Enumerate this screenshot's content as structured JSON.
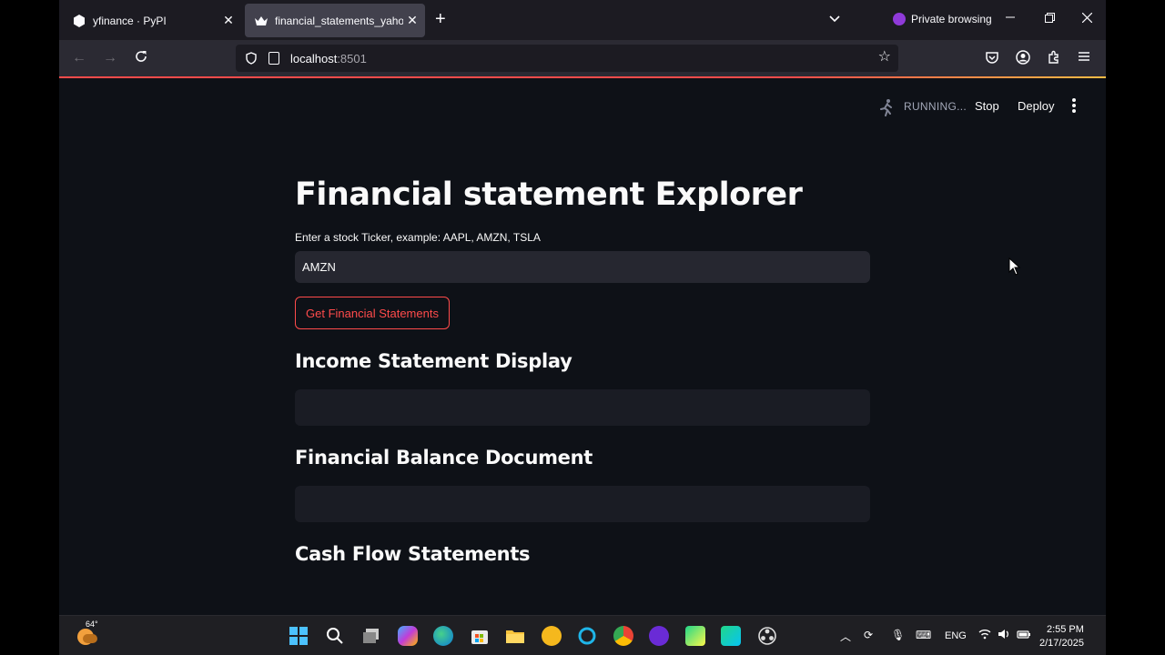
{
  "browser": {
    "tabs": [
      {
        "title": "yfinance · PyPI",
        "active": false
      },
      {
        "title": "financial_statements_yahoofinar",
        "active": true
      }
    ],
    "private_label": "Private browsing",
    "url_host": "localhost",
    "url_port": ":8501"
  },
  "streamlit_header": {
    "status": "RUNNING...",
    "stop_label": "Stop",
    "deploy_label": "Deploy"
  },
  "app": {
    "title": "Financial statement Explorer",
    "ticker_label": "Enter a stock Ticker, example: AAPL, AMZN, TSLA",
    "ticker_value": "AMZN",
    "button_label": "Get Financial Statements",
    "sections": [
      {
        "heading": "Income Statement Display"
      },
      {
        "heading": "Financial Balance Document"
      },
      {
        "heading": "Cash Flow Statements"
      }
    ]
  },
  "taskbar": {
    "temperature": "64°",
    "language": "ENG",
    "time": "2:55 PM",
    "date": "2/17/2025"
  },
  "colors": {
    "accent": "#ff4b4b",
    "background": "#0e1117",
    "input_bg": "#262730"
  }
}
